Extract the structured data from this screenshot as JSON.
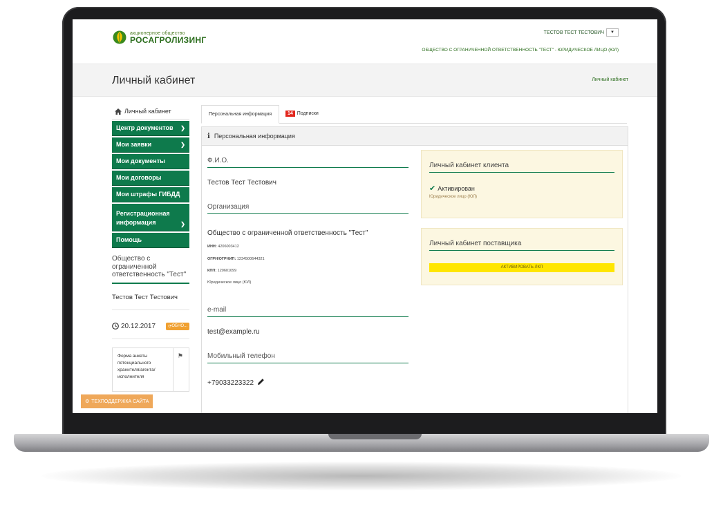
{
  "header": {
    "logo_small": "акционерное общество",
    "logo_big": "РОСАГРОЛИЗИНГ",
    "user_name": "ТЕСТОВ ТЕСТ ТЕСТОВИЧ",
    "dropdown_icon": "caret-down-icon",
    "org_line": "ОБЩЕСТВО С ОГРАНИЧЕННОЙ ОТВЕТСТВЕННОСТЬ \"ТЕСТ\"  - ЮРИДИЧЕСКОЕ ЛИЦО (ЮЛ)"
  },
  "titlebar": {
    "title": "Личный кабинет",
    "breadcrumb": "Личный кабинет"
  },
  "sidebar": {
    "home_label": "Личный кабинет",
    "items": [
      {
        "label": "Центр документов",
        "has_chevron": true
      },
      {
        "label": "Мои заявки",
        "has_chevron": true
      },
      {
        "label": "Мои документы",
        "has_chevron": false
      },
      {
        "label": "Мои договоры",
        "has_chevron": false
      },
      {
        "label": "Мои штрафы ГИБДД",
        "has_chevron": false
      },
      {
        "label": "Регистрационная информация",
        "has_chevron": true
      },
      {
        "label": "Помощь",
        "has_chevron": false
      }
    ],
    "org_name": "Общество с ограниченной ответственность \"Тест\"",
    "user_name": "Тестов Тест Тестович",
    "date": "20.12.2017",
    "refresh_label": "ОБНО...",
    "form_text": "Форма анкеты потенциального хранителя/агента/исполнителя",
    "support_label": "ТЕХПОДДЕРЖКА САЙТА"
  },
  "tabs": [
    {
      "label": "Персональная информация",
      "active": true
    },
    {
      "label": "Подписки",
      "badge": "14",
      "active": false
    }
  ],
  "panel": {
    "title": "Персональная информация",
    "fio_label": "Ф.И.О.",
    "fio_value": "Тестов Тест Тестович",
    "org_label": "Организация",
    "org_value": "Общество с ограниченной ответственность \"Тест\"",
    "inn_label": "ИНН:",
    "inn_value": "4206003412",
    "ogrn_label": "ОГРН/ОГРНИП:",
    "ogrn_value": "1234500644321",
    "kpp_label": "КПП:",
    "kpp_value": "120601099",
    "entity_type": "Юридическое лицо (ЮЛ)",
    "email_label": "e-mail",
    "email_value": "test@example.ru",
    "phone_label": "Мобильный телефон",
    "phone_value": "+79033223322"
  },
  "client_card": {
    "title": "Личный кабинет клиента",
    "status": "Активирован",
    "status_sub": "Юридическое лицо (ЮЛ)"
  },
  "supplier_card": {
    "title": "Личный кабинет поставщика",
    "button_label": "АКТИВИРОВАТЬ ЛКП"
  },
  "colors": {
    "brand_green": "#0e7a4c",
    "badge_red": "#e2261c",
    "activate_yellow": "#ffe600",
    "support_orange": "#efa85a"
  }
}
